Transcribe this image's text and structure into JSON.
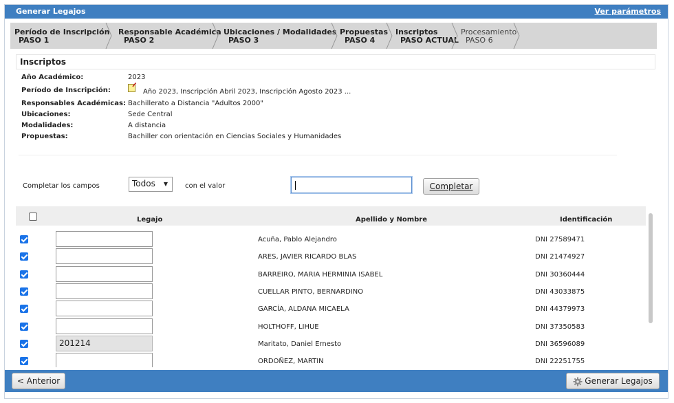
{
  "window": {
    "title": "Generar Legajos",
    "params_link": "Ver parámetros"
  },
  "steps": [
    {
      "name": "Período de Inscripción",
      "sub": "PASO 1"
    },
    {
      "name": "Responsable Académica",
      "sub": "PASO 2"
    },
    {
      "name": "Ubicaciones / Modalidades",
      "sub": "PASO 3"
    },
    {
      "name": "Propuestas",
      "sub": "PASO 4"
    },
    {
      "name": "Inscriptos",
      "sub": "PASO ACTUAL"
    },
    {
      "name": "Procesamiento",
      "sub": "PASO 6"
    }
  ],
  "section": {
    "title": "Inscriptos"
  },
  "info": [
    {
      "label": "Año Académico:",
      "value": "2023"
    },
    {
      "label": "Período de Inscripción:",
      "value": "Año 2023, Inscripción Abril 2023, Inscripción Agosto 2023 ..."
    },
    {
      "label": "Responsables Académicas:",
      "value": "Bachillerato a Distancia \"Adultos 2000\""
    },
    {
      "label": "Ubicaciones:",
      "value": "Sede Central"
    },
    {
      "label": "Modalidades:",
      "value": "A distancia"
    },
    {
      "label": "Propuestas:",
      "value": "Bachiller con orientación en Ciencias Sociales y Humanidades"
    }
  ],
  "fill": {
    "label_fields": "Completar los campos",
    "select_value": "Todos",
    "label_value": "con el valor",
    "input_value": "",
    "button": "Completar"
  },
  "grid": {
    "headers": {
      "legajo": "Legajo",
      "nombre": "Apellido y Nombre",
      "id": "Identificación"
    },
    "rows": [
      {
        "checked": true,
        "legajo": "",
        "nombre": "Acuña, Pablo Alejandro",
        "id": "DNI 27589471"
      },
      {
        "checked": true,
        "legajo": "",
        "nombre": "ARES, JAVIER RICARDO BLAS",
        "id": "DNI 21474927"
      },
      {
        "checked": true,
        "legajo": "",
        "nombre": "BARREIRO, MARIA HERMINIA ISABEL",
        "id": "DNI 30360444"
      },
      {
        "checked": true,
        "legajo": "",
        "nombre": "CUELLAR PINTO, BERNARDINO",
        "id": "DNI 43033875"
      },
      {
        "checked": true,
        "legajo": "",
        "nombre": "GARCÍA, ALDANA MICAELA",
        "id": "DNI 44379973"
      },
      {
        "checked": true,
        "legajo": "",
        "nombre": "HOLTHOFF, LIHUE",
        "id": "DNI 37350583"
      },
      {
        "checked": true,
        "legajo": "201214",
        "nombre": "Maritato, Daniel Ernesto",
        "id": "DNI 36596089"
      },
      {
        "checked": true,
        "legajo": "",
        "nombre": "ORDOÑEZ, MARTIN",
        "id": "DNI 22251755"
      }
    ]
  },
  "footer": {
    "back": "< Anterior",
    "generate": "Generar Legajos"
  },
  "colors": {
    "accent": "#3f7fc1",
    "checkbox": "#1a73e8"
  }
}
